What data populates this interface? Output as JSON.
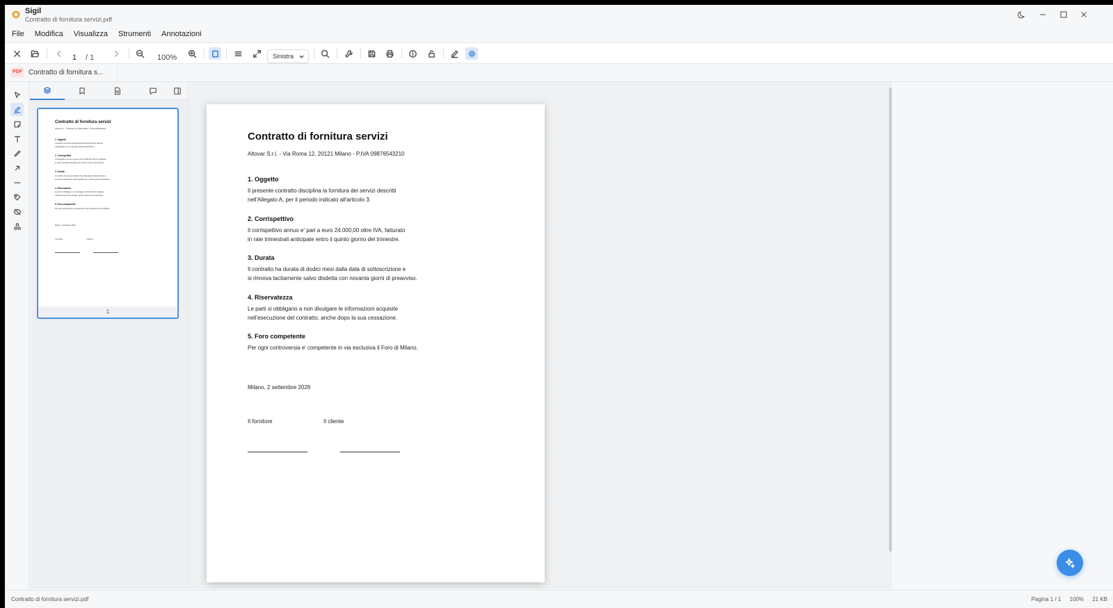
{
  "window": {
    "app_name": "Sigil",
    "file_name": "Contratto di fornitura servizi.pdf"
  },
  "menu": [
    "File",
    "Modifica",
    "Visualizza",
    "Strumenti",
    "Annotazioni"
  ],
  "toolbar": {
    "page_current": "1",
    "page_total": "/ 1",
    "zoom": "100%",
    "align": "Sinistra"
  },
  "tab": {
    "badge": "PDF",
    "label": "Contratto di fornitura s..."
  },
  "thumbnail": {
    "page_number": "1"
  },
  "document": {
    "title": "Contratto di fornitura servizi",
    "subtitle": "Altovar S.r.l. - Via Roma 12, 20121 Milano - P.IVA 09876543210",
    "sections": [
      {
        "heading": "1. Oggetto",
        "lines": [
          "Il presente contratto disciplina la fornitura dei servizi descritti",
          "nell'Allegato A, per il periodo indicato all'articolo 3."
        ]
      },
      {
        "heading": "2. Corrispettivo",
        "lines": [
          "Il corrispettivo annuo e' pari a euro 24.000,00 oltre IVA, fatturato",
          "in rate trimestrali anticipate entro il quinto giorno del trimestre."
        ]
      },
      {
        "heading": "3. Durata",
        "lines": [
          "Il contratto ha durata di dodici mesi dalla data di sottoscrizione e",
          "si rinnova tacitamente salvo disdetta con novanta giorni di preavviso."
        ]
      },
      {
        "heading": "4. Riservatezza",
        "lines": [
          "Le parti si obbligano a non divulgare le informazioni acquisite",
          "nell'esecuzione del contratto, anche dopo la sua cessazione."
        ]
      },
      {
        "heading": "5. Foro competente",
        "lines": [
          "Per ogni controversia e' competente in via esclusiva il Foro di Milano."
        ]
      }
    ],
    "place_date": "Milano, 2 settembre 2026",
    "signer_1": "Il fornitore",
    "signer_2": "Il cliente"
  },
  "status": {
    "file": "Contratto di fornitura servizi.pdf",
    "page": "Pagina 1 / 1",
    "zoom": "100%",
    "size": "21 KB"
  }
}
